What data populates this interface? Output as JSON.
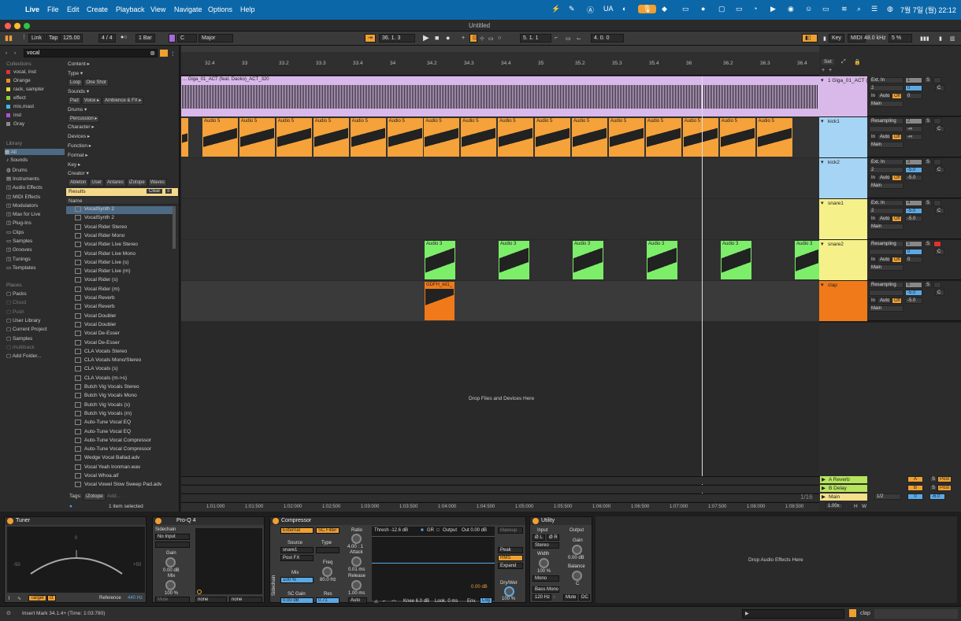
{
  "menubar": {
    "app": "Live",
    "items": [
      "File",
      "Edit",
      "Create",
      "Playback",
      "View",
      "Navigate",
      "Options",
      "Help"
    ],
    "lang": "UA",
    "datetime": "7월 7일 (월) 22:12"
  },
  "window": {
    "title": "Untitled"
  },
  "control": {
    "link": "Link",
    "tap": "Tap",
    "tempo": "125.00",
    "sig": "4 / 4",
    "metro": "●○",
    "quant": "1 Bar",
    "key": "C",
    "scale": "Major",
    "pos": "36.  1.  3",
    "loop_start": "5.  1.  1",
    "loop_len": "4.  0.  0",
    "key_btn": "Key",
    "midi": "MIDI",
    "sr": "48.0 kHz",
    "cpu": "5 %"
  },
  "browser": {
    "search": "vocal",
    "collections_title": "Collections",
    "collections": [
      {
        "label": "vocal, inst",
        "color": "#e0333b"
      },
      {
        "label": "Orange",
        "color": "#f08a24"
      },
      {
        "label": "rack, sampler",
        "color": "#e9d645"
      },
      {
        "label": "effect",
        "color": "#8bd03a"
      },
      {
        "label": "mix,mast",
        "color": "#3fb6e8"
      },
      {
        "label": "inst",
        "color": "#b050d8"
      },
      {
        "label": "Gray",
        "color": "#8a8a8a"
      }
    ],
    "library_title": "Library",
    "library": [
      "All",
      "Sounds",
      "Drums",
      "Instruments",
      "Audio Effects",
      "MIDI Effects",
      "Modulators",
      "Max for Live",
      "Plug-Ins",
      "Clips",
      "Samples",
      "Grooves",
      "Tunings",
      "Templates"
    ],
    "places_title": "Places",
    "places": [
      "Packs",
      "Cloud",
      "Push",
      "User Library",
      "Current Project",
      "Samples",
      "multitrack",
      "Add Folder..."
    ],
    "filters": {
      "content": "Content ▸",
      "type": "Type ▾",
      "type_tags": [
        "Loop",
        "One Shot"
      ],
      "sounds": "Sounds ▾",
      "sounds_tags": [
        "Pad",
        "Voice ▸",
        "Ambience & FX ▸"
      ],
      "drums": "Drums ▾",
      "drums_tags": [
        "Percussion ▸"
      ],
      "character": "Character ▸",
      "devices": "Devices ▸",
      "function": "Function ▸",
      "format": "Format ▸",
      "key": "Key ▸",
      "creator": "Creator ▾",
      "creator_tags": [
        "Ableton",
        "User",
        "Antares",
        "iZotope",
        "Waves"
      ]
    },
    "results_label": "Results",
    "clear": "Clear",
    "name_header": "Name",
    "results": [
      "VocalSynth 2",
      "VocalSynth 2",
      "Vocal Rider Stereo",
      "Vocal Rider Mono",
      "Vocal Rider Live Stereo",
      "Vocal Rider Live Mono",
      "Vocal Rider Live (s)",
      "Vocal Rider Live (m)",
      "Vocal Rider (s)",
      "Vocal Rider (m)",
      "Vocal Reverb",
      "Vocal Reverb",
      "Vocal Doubler",
      "Vocal Doubler",
      "Vocal De-Esser",
      "Vocal De-Esser",
      "CLA Vocals Stereo",
      "CLA Vocals Mono/Stereo",
      "CLA Vocals (s)",
      "CLA Vocals (m->s)",
      "Butch Vig Vocals Stereo",
      "Butch Vig Vocals Mono",
      "Butch Vig Vocals (s)",
      "Butch Vig Vocals (m)",
      "Auto-Tune Vocal EQ",
      "Auto-Tune Vocal EQ",
      "Auto-Tune Vocal Compressor",
      "Auto-Tune Vocal Compressor",
      "Wedge Vocal Ballad.adv",
      "Vocal Yeah Ironman.wav",
      "Vocal Whoa.aif",
      "Vocal Vowel Slow Sweep Pad.adv"
    ],
    "tags_label": "Tags:",
    "tag_value": "iZotope",
    "add": "Add...",
    "selected": "1 item selected"
  },
  "arrangement": {
    "ruler": [
      "32.4",
      "33",
      "33.2",
      "33.3",
      "33.4",
      "34",
      "34.2",
      "34.3",
      "34.4",
      "35",
      "35.2",
      "35.3",
      "35.4",
      "36",
      "36.2",
      "36.3",
      "36.4"
    ],
    "time_ruler": [
      "1:01:000",
      "1:01:500",
      "1:02:000",
      "1:02:500",
      "1:03:000",
      "1:03:500",
      "1:04:000",
      "1:04:500",
      "1:05:000",
      "1:05:500",
      "1:06:000",
      "1:06:500",
      "1:07:000",
      "1:07:500",
      "1:08:000",
      "1:08:500"
    ],
    "set": "Set",
    "drop_hint": "Drop Files and Devices Here",
    "grid": "1/16",
    "clip_giga": "... Giga_01_ACT (feat. Daoko)_ACT_320",
    "clip_audio5": "Audio 5",
    "clip_audio3": "Audio 3",
    "clip_clap": "GDFH_kit1_"
  },
  "tracks": [
    {
      "name": "1 Giga_01_ACT (",
      "input": "Ext. In",
      "ch": "2",
      "vol": "0",
      "num": "1",
      "pan": "C",
      "color": "#d9b8ea"
    },
    {
      "name": "kick1",
      "input": "Resampling",
      "ch": "",
      "vol": "-∞",
      "num": "2",
      "pan": "C",
      "color": "#a6d4f5"
    },
    {
      "name": "kick2",
      "input": "Ext. In",
      "ch": "2",
      "vol": "-5.0",
      "num": "3",
      "pan": "C",
      "color": "#a6d4f5"
    },
    {
      "name": "snare1",
      "input": "Ext. In",
      "ch": "2",
      "vol": "-5.0",
      "num": "4",
      "pan": "C",
      "color": "#f5f08a"
    },
    {
      "name": "snare2",
      "input": "Resampling",
      "ch": "",
      "vol": "0",
      "num": "5",
      "pan": "C",
      "color": "#f5f08a"
    },
    {
      "name": "clap",
      "input": "Resampling",
      "ch": "",
      "vol": "-5.0",
      "num": "6",
      "pan": "C",
      "color": "#f07a1a"
    }
  ],
  "returns": [
    {
      "name": "A Reverb",
      "letter": "A",
      "post": "Post"
    },
    {
      "name": "B Delay",
      "letter": "B",
      "post": "Post"
    }
  ],
  "main": {
    "name": "Main",
    "sel": "1/2",
    "vol": "0",
    "vol2": "-6.0",
    "tempo_scale": "1.00x",
    "h": "H",
    "w": "W"
  },
  "mix_labels": {
    "in": "In",
    "auto": "Auto",
    "off": "Off",
    "main": "Main",
    "s": "S",
    "c": "C"
  },
  "devices": {
    "tuner": {
      "title": "Tuner",
      "ref_label": "Reference",
      "ref": "440 Hz",
      "target": "Target",
      "ct": "ct",
      "minus": "-50",
      "zero": "0",
      "plus": "+50"
    },
    "proq": {
      "title": "Pro-Q 4",
      "sidechain": "Sidechain",
      "no_input": "No Input",
      "gain": "Gain",
      "gain_v": "0.00 dB",
      "mix": "Mix",
      "mix_v": "100 %",
      "mute": "Mute",
      "none1": "none",
      "none2": "none"
    },
    "comp": {
      "title": "Compressor",
      "external": "External",
      "scfilter": "SC Filter",
      "source": "Source",
      "src_v": "snare1",
      "post": "Post FX",
      "type": "Type",
      "mix": "Mix",
      "mix_v": "100 %",
      "freq": "Freq",
      "freq_v": "80.0 Hz",
      "scgain": "SC Gain",
      "scgain_v": "0.00 dB",
      "res": "Res",
      "res_v": "0.71",
      "ratio": "Ratio",
      "ratio_v": "4.00 : 1",
      "attack": "Attack",
      "attack_v": "0.01 ms",
      "release": "Release",
      "release_v": "1.00 ms",
      "auto": "Auto",
      "thresh": "Thresh -12.6 dB",
      "gr": "GR",
      "output": "Output",
      "out": "Out 0.00 dB",
      "gr_v": "0.00 dB",
      "knee": "Knee 6.0 dB",
      "look": "Look. 0 ms",
      "env": "Env.",
      "log": "Log",
      "makeup": "Makeup",
      "peak": "Peak",
      "rms": "RMS",
      "expand": "Expand",
      "drywet": "Dry/Wet",
      "drywet_v": "100 %",
      "sidechain_v": "Sidechain"
    },
    "utility": {
      "title": "Utility",
      "input": "Input",
      "output": "Output",
      "phl": "Ø L",
      "phr": "Ø R",
      "stereo": "Stereo",
      "width": "Width",
      "width_v": "100 %",
      "mono": "Mono",
      "bassmono": "Bass Mono",
      "bass_hz": "120 Hz",
      "gain": "Gain",
      "gain_v": "0.00 dB",
      "balance": "Balance",
      "bal_v": "C",
      "mute": "Mute",
      "dc": "DC"
    },
    "drop": "Drop Audio Effects Here"
  },
  "status": {
    "msg": "Insert Mark 34.1.4+ (Time: 1:03:780)",
    "track": "clap"
  }
}
